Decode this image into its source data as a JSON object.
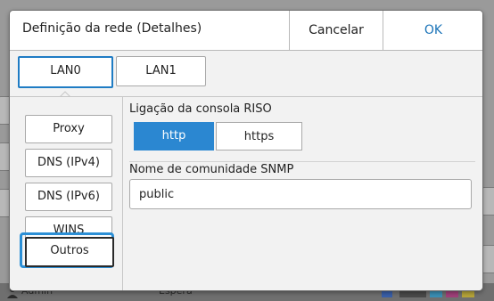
{
  "dialog": {
    "title": "Definição da rede (Detalhes)",
    "cancel_label": "Cancelar",
    "ok_label": "OK"
  },
  "tabs": [
    {
      "label": "LAN0",
      "selected": true
    },
    {
      "label": "LAN1",
      "selected": false
    }
  ],
  "sidebar": {
    "items": [
      {
        "label": "Proxy",
        "selected": false
      },
      {
        "label": "DNS (IPv4)",
        "selected": false
      },
      {
        "label": "DNS (IPv6)",
        "selected": false
      },
      {
        "label": "WINS",
        "selected": false
      },
      {
        "label": "Outros",
        "selected": true
      }
    ]
  },
  "riso_console": {
    "label": "Ligação da consola RISO",
    "options": [
      "http",
      "https"
    ],
    "selected": "http"
  },
  "snmp": {
    "label": "Nome de comunidade SNMP",
    "value": "public"
  },
  "background": {
    "user_label": "Admin",
    "status_label": "Espera"
  },
  "colors": {
    "accent": "#2b87d1",
    "ok_text": "#1a73b8",
    "focus_ring": "#2b8fd6"
  }
}
